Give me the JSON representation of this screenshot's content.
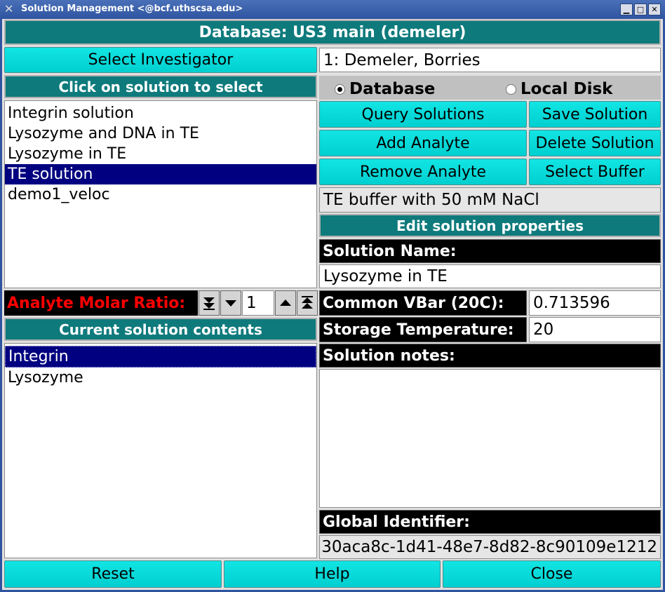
{
  "window": {
    "title": "Solution Management <@bcf.uthscsa.edu>"
  },
  "header": {
    "database_title": "Database: US3 main (demeler)"
  },
  "investigator": {
    "button_label": "Select Investigator",
    "value": "1: Demeler, Borries"
  },
  "solutions": {
    "header": "Click on solution to select",
    "items": [
      "Integrin solution",
      "Lysozyme and DNA in TE",
      "Lysozyme in TE",
      "TE solution",
      "demo1_veloc"
    ],
    "selected": "TE solution"
  },
  "source": {
    "database_label": "Database",
    "local_label": "Local Disk",
    "selected": "Database"
  },
  "actions": {
    "query": "Query Solutions",
    "save": "Save Solution",
    "add_analyte": "Add Analyte",
    "delete": "Delete Solution",
    "remove_analyte": "Remove Analyte",
    "select_buffer": "Select Buffer"
  },
  "buffer": {
    "value": "TE buffer with 50 mM NaCl"
  },
  "properties": {
    "header": "Edit solution properties",
    "name_label": "Solution Name:",
    "name_value": "Lysozyme in TE",
    "vbar_label": "Common VBar (20C):",
    "vbar_value": "0.713596",
    "temp_label": "Storage Temperature:",
    "temp_value": "20",
    "notes_label": "Solution notes:",
    "notes_value": "",
    "guid_label": "Global Identifier:",
    "guid_value": "30aca8c-1d41-48e7-8d82-8c90109e1212"
  },
  "molar_ratio": {
    "label": "Analyte Molar Ratio:",
    "value": "1",
    "color": "#ff0000"
  },
  "contents": {
    "header": "Current solution contents",
    "items": [
      "Integrin",
      "Lysozyme"
    ],
    "selected": "Integrin"
  },
  "footer": {
    "reset": "Reset",
    "help": "Help",
    "close": "Close"
  },
  "colors": {
    "teal_banner": "#0e7a7c",
    "cyan_button": "#00d8d8",
    "selection": "#000080"
  }
}
